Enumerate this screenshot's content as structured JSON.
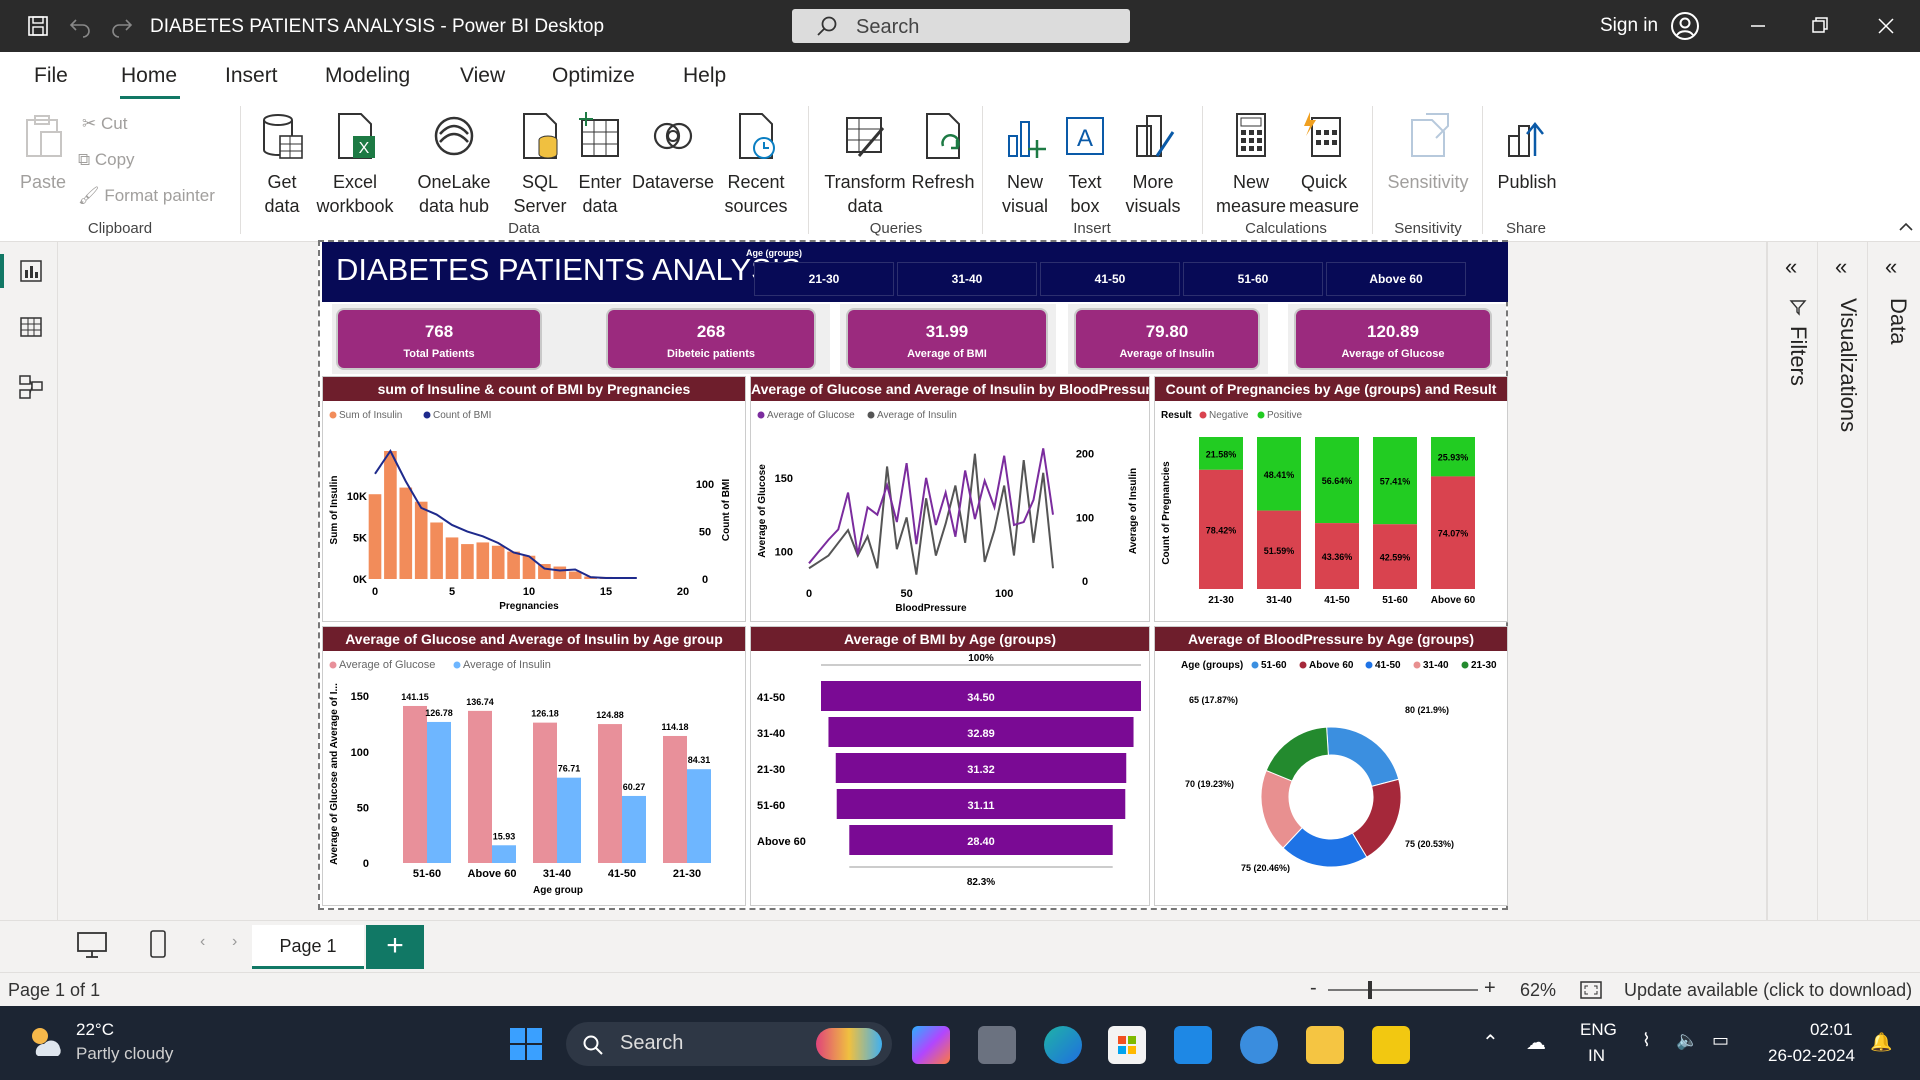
{
  "window": {
    "title": "DIABETES PATIENTS ANALYSIS - Power BI Desktop",
    "search_placeholder": "Search",
    "sign_in": "Sign in"
  },
  "menu": [
    "File",
    "Home",
    "Insert",
    "Modeling",
    "View",
    "Optimize",
    "Help"
  ],
  "ribbon": {
    "clipboard": {
      "paste": "Paste",
      "cut": "Cut",
      "copy": "Copy",
      "format_painter": "Format painter",
      "label": "Clipboard"
    },
    "data": {
      "get_data": "Get data",
      "excel": "Excel workbook",
      "onelake": "OneLake data hub",
      "sql": "SQL Server",
      "enter": "Enter data",
      "dataverse": "Dataverse",
      "recent": "Recent sources",
      "label": "Data"
    },
    "queries": {
      "transform": "Transform data",
      "refresh": "Refresh",
      "label": "Queries"
    },
    "insert": {
      "new_visual": "New visual",
      "text_box": "Text box",
      "more_visuals": "More visuals",
      "label": "Insert"
    },
    "calculations": {
      "new_measure": "New measure",
      "quick_measure": "Quick measure",
      "label": "Calculations"
    },
    "sensitivity": {
      "sensitivity": "Sensitivity",
      "label": "Sensitivity"
    },
    "share": {
      "publish": "Publish",
      "label": "Share"
    }
  },
  "report": {
    "title": "DIABETES PATIENTS ANALYSIS",
    "slicer": {
      "title": "Age (groups)",
      "options": [
        "21-30",
        "31-40",
        "41-50",
        "51-60",
        "Above 60"
      ]
    },
    "kpis": [
      {
        "value": "768",
        "label": "Total Patients"
      },
      {
        "value": "268",
        "label": "Dibeteic patients"
      },
      {
        "value": "31.99",
        "label": "Average of BMI"
      },
      {
        "value": "79.80",
        "label": "Average of Insulin"
      },
      {
        "value": "120.89",
        "label": "Average of Glucose"
      }
    ]
  },
  "chart_data": [
    {
      "type": "bar",
      "title": "sum of Insuline & count of BMI by Pregnancies",
      "legend": [
        "Sum of Insulin",
        "Count of BMI"
      ],
      "xlabel": "Pregnancies",
      "ylabel": "Sum of Insulin",
      "y2label": "Count of BMI",
      "x": [
        0,
        1,
        2,
        3,
        4,
        5,
        6,
        7,
        8,
        9,
        10,
        11,
        12,
        13,
        14,
        15,
        17
      ],
      "series": [
        {
          "name": "Sum of Insulin",
          "values": [
            10200,
            15400,
            11000,
            9300,
            6800,
            5000,
            4200,
            4400,
            4000,
            3300,
            2800,
            1800,
            1500,
            900,
            300,
            250,
            0
          ]
        },
        {
          "name": "Count of BMI",
          "values": [
            111,
            135,
            103,
            75,
            68,
            57,
            50,
            45,
            38,
            28,
            24,
            11,
            9,
            10,
            2,
            1,
            1
          ]
        }
      ],
      "yticks": [
        "0K",
        "5K",
        "10K"
      ],
      "y2ticks": [
        "0",
        "50",
        "100"
      ],
      "xticks": [
        "0",
        "5",
        "10",
        "15",
        "20"
      ],
      "colors": {
        "bar": "#f28c5a",
        "line": "#1e2a8c"
      }
    },
    {
      "type": "line",
      "title": "Average of Glucose and Average of Insulin by BloodPressure",
      "legend": [
        "Average of Glucose",
        "Average of Insulin"
      ],
      "xlabel": "BloodPressure",
      "ylabel": "Average of Glucose",
      "y2label": "Average of Insulin",
      "yticks": [
        "100",
        "150"
      ],
      "y2ticks": [
        "0",
        "100",
        "200"
      ],
      "xticks": [
        "0",
        "50",
        "100"
      ],
      "series": [
        {
          "name": "Average of Glucose",
          "values": [
            92,
            100,
            108,
            115,
            140,
            98,
            130,
            125,
            145,
            120,
            160,
            105,
            150,
            118,
            140,
            110,
            155,
            122,
            148,
            130,
            165,
            118,
            120,
            135,
            170,
            125
          ]
        },
        {
          "name": "Average of Insulin",
          "values": [
            20,
            30,
            40,
            60,
            80,
            40,
            70,
            20,
            180,
            50,
            100,
            10,
            130,
            40,
            90,
            150,
            60,
            200,
            30,
            80,
            150,
            40,
            190,
            60,
            170,
            20
          ]
        }
      ],
      "colors": {
        "glucose": "#7b2c9e",
        "insulin": "#555555"
      }
    },
    {
      "type": "bar",
      "title": "Count of Pregnancies by Age (groups) and Result",
      "legend_title": "Result",
      "legend": [
        "Negative",
        "Positive"
      ],
      "ylabel": "Count of Pregnancies",
      "categories": [
        "21-30",
        "31-40",
        "41-50",
        "51-60",
        "Above 60"
      ],
      "series": [
        {
          "name": "Negative",
          "values": [
            78.42,
            51.59,
            43.36,
            42.59,
            74.07
          ],
          "labels": [
            "78.42%",
            "51.59%",
            "43.36%",
            "42.59%",
            "74.07%"
          ]
        },
        {
          "name": "Positive",
          "values": [
            21.58,
            48.41,
            56.64,
            57.41,
            25.93
          ],
          "labels": [
            "21.58%",
            "48.41%",
            "56.64%",
            "57.41%",
            "25.93%"
          ]
        }
      ],
      "colors": {
        "negative": "#d9434f",
        "positive": "#22cc22"
      }
    },
    {
      "type": "bar",
      "title": "Average of Glucose and Average of Insulin by Age group",
      "legend": [
        "Average of Glucose",
        "Average of Insulin"
      ],
      "xlabel": "Age group",
      "ylabel": "Average of Glucose and Average of I...",
      "categories": [
        "51-60",
        "Above 60",
        "31-40",
        "41-50",
        "21-30"
      ],
      "series": [
        {
          "name": "Average of Glucose",
          "values": [
            141.15,
            136.74,
            126.18,
            124.88,
            114.18
          ]
        },
        {
          "name": "Average of Insulin",
          "values": [
            126.78,
            15.93,
            76.71,
            60.27,
            84.31
          ]
        }
      ],
      "yticks": [
        "0",
        "50",
        "100",
        "150"
      ],
      "ylim": [
        0,
        160
      ],
      "colors": {
        "glucose": "#e8909a",
        "insulin": "#6eb6ff"
      }
    },
    {
      "type": "bar",
      "title": "Average of BMI by Age (groups)",
      "top_label": "100%",
      "bottom_label": "82.3%",
      "categories": [
        "41-50",
        "31-40",
        "21-30",
        "51-60",
        "Above 60"
      ],
      "values": [
        34.5,
        32.89,
        31.32,
        31.11,
        28.4
      ],
      "labels": [
        "34.50",
        "32.89",
        "31.32",
        "31.11",
        "28.40"
      ],
      "colors": {
        "bar": "#7a0a94"
      }
    },
    {
      "type": "pie",
      "title": "Average of BloodPressure by Age (groups)",
      "legend_title": "Age (groups)",
      "legend": [
        "51-60",
        "Above 60",
        "41-50",
        "31-40",
        "21-30"
      ],
      "categories": [
        "51-60",
        "Above 60",
        "41-50",
        "31-40",
        "21-30"
      ],
      "values": [
        80,
        75,
        75,
        70,
        65
      ],
      "labels": [
        "80 (21.9%)",
        "75 (20.53%)",
        "75 (20.46%)",
        "70 (19.23%)",
        "65 (17.87%)"
      ],
      "colors": [
        "#3b8fe0",
        "#a5283a",
        "#1e73e6",
        "#e89090",
        "#238a2e"
      ]
    }
  ],
  "panes": {
    "filters": "Filters",
    "visualizations": "Visualizations",
    "data": "Data"
  },
  "pages": {
    "tab": "Page 1",
    "add": "+"
  },
  "status": {
    "page": "Page 1 of 1",
    "zoom": "62%",
    "update": "Update available (click to download)"
  },
  "taskbar": {
    "temp": "22°C",
    "weather": "Partly cloudy",
    "search": "Search",
    "lang1": "ENG",
    "lang2": "IN",
    "time": "02:01",
    "date": "26-02-2024"
  }
}
